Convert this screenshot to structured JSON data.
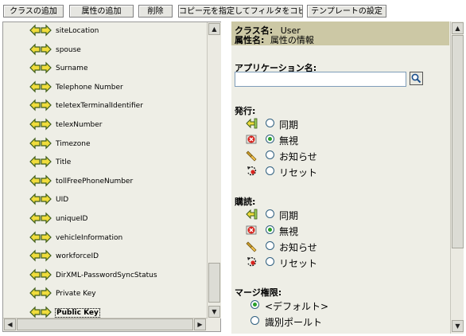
{
  "toolbar": {
    "add_class": "クラスの追加",
    "add_attribute": "属性の追加",
    "delete": "削除",
    "copy_filter": "コピー元を指定してフィルタをコピー...",
    "template_settings": "テンプレートの設定"
  },
  "tree": {
    "items": [
      {
        "label": "siteLocation"
      },
      {
        "label": "spouse"
      },
      {
        "label": "Surname"
      },
      {
        "label": "Telephone Number"
      },
      {
        "label": "teletexTerminalIdentifier"
      },
      {
        "label": "telexNumber"
      },
      {
        "label": "Timezone"
      },
      {
        "label": "Title"
      },
      {
        "label": "tollFreePhoneNumber"
      },
      {
        "label": "UID"
      },
      {
        "label": "uniqueID"
      },
      {
        "label": "vehicleInformation"
      },
      {
        "label": "workforceID"
      },
      {
        "label": "DirXML-PasswordSyncStatus"
      },
      {
        "label": "Private Key"
      },
      {
        "label": "Public Key"
      }
    ],
    "selected_index": 15
  },
  "details": {
    "class_key": "クラス名:",
    "class_value": "User",
    "attr_key": "属性名:",
    "attr_value": "属性の情報",
    "app_name_label": "アプリケーション名:",
    "app_name_value": "",
    "publish": {
      "title": "発行:",
      "options": [
        {
          "label": "同期",
          "icon": "sync-icon",
          "checked": false
        },
        {
          "label": "無視",
          "icon": "ignore-icon",
          "checked": true
        },
        {
          "label": "お知らせ",
          "icon": "notify-icon",
          "checked": false
        },
        {
          "label": "リセット",
          "icon": "reset-icon",
          "checked": false
        }
      ]
    },
    "subscribe": {
      "title": "購読:",
      "options": [
        {
          "label": "同期",
          "icon": "sync-icon",
          "checked": false
        },
        {
          "label": "無視",
          "icon": "ignore-icon",
          "checked": true
        },
        {
          "label": "お知らせ",
          "icon": "notify-icon",
          "checked": false
        },
        {
          "label": "リセット",
          "icon": "reset-icon",
          "checked": false
        }
      ]
    },
    "merge": {
      "title": "マージ権限:",
      "options": [
        {
          "label": "<デフォルト>",
          "checked": true
        },
        {
          "label": "識別ポールト",
          "checked": false
        }
      ]
    }
  },
  "colors": {
    "panel_bg": "#eeeee6",
    "header_bg": "#ccc8a5",
    "radio_checked": "#2aa02a"
  }
}
